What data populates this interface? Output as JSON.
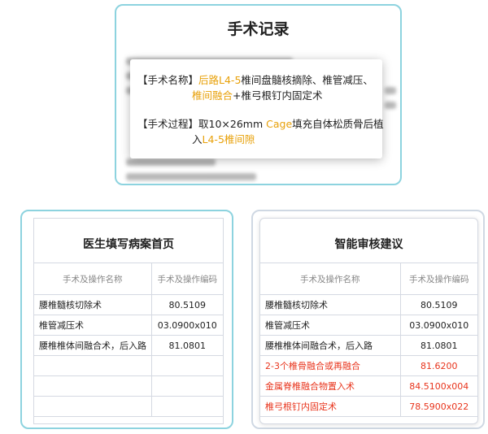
{
  "top": {
    "title": "手术记录",
    "popup": {
      "line1_prefix": "【手术名称】",
      "line1_hl1": "后路L4-5",
      "line1_rest": "椎间盘髓核摘除、椎管减压、",
      "line2_hl": "椎间融合",
      "line2_rest": "+椎弓根钉内固定术",
      "line3_prefix": "【手术过程】",
      "line3_text1": "取10×26mm ",
      "line3_hl": "Cage",
      "line3_text2": "填充自体松质骨后植",
      "line4_text": "入",
      "line4_hl": "L4-5椎间隙"
    }
  },
  "left": {
    "title": "医生填写病案首页",
    "headers": [
      "手术及操作名称",
      "手术及操作编码"
    ],
    "rows": [
      {
        "name": "腰椎髓核切除术",
        "code": "80.5109"
      },
      {
        "name": "椎管减压术",
        "code": "03.0900x010"
      },
      {
        "name": "腰椎椎体间融合术，后入路",
        "code": "81.0801"
      },
      {
        "name": "",
        "code": ""
      },
      {
        "name": "",
        "code": ""
      },
      {
        "name": "",
        "code": ""
      }
    ]
  },
  "right": {
    "title": "智能审核建议",
    "headers": [
      "手术及操作名称",
      "手术及操作编码"
    ],
    "rows": [
      {
        "name": "腰椎髓核切除术",
        "code": "80.5109"
      },
      {
        "name": "椎管减压术",
        "code": "03.0900x010"
      },
      {
        "name": "腰椎椎体间融合术，后入路",
        "code": "81.0801"
      },
      {
        "name": "2-3个椎骨融合或再融合",
        "code": "81.6200"
      },
      {
        "name": "金属脊椎融合物置入术",
        "code": "84.5100x004"
      },
      {
        "name": "椎弓根钉内固定术",
        "code": "78.5900x022"
      }
    ]
  },
  "colors": {
    "accent": "#8dd3df",
    "highlight": "#e8a10a",
    "warning": "#e8341c"
  }
}
